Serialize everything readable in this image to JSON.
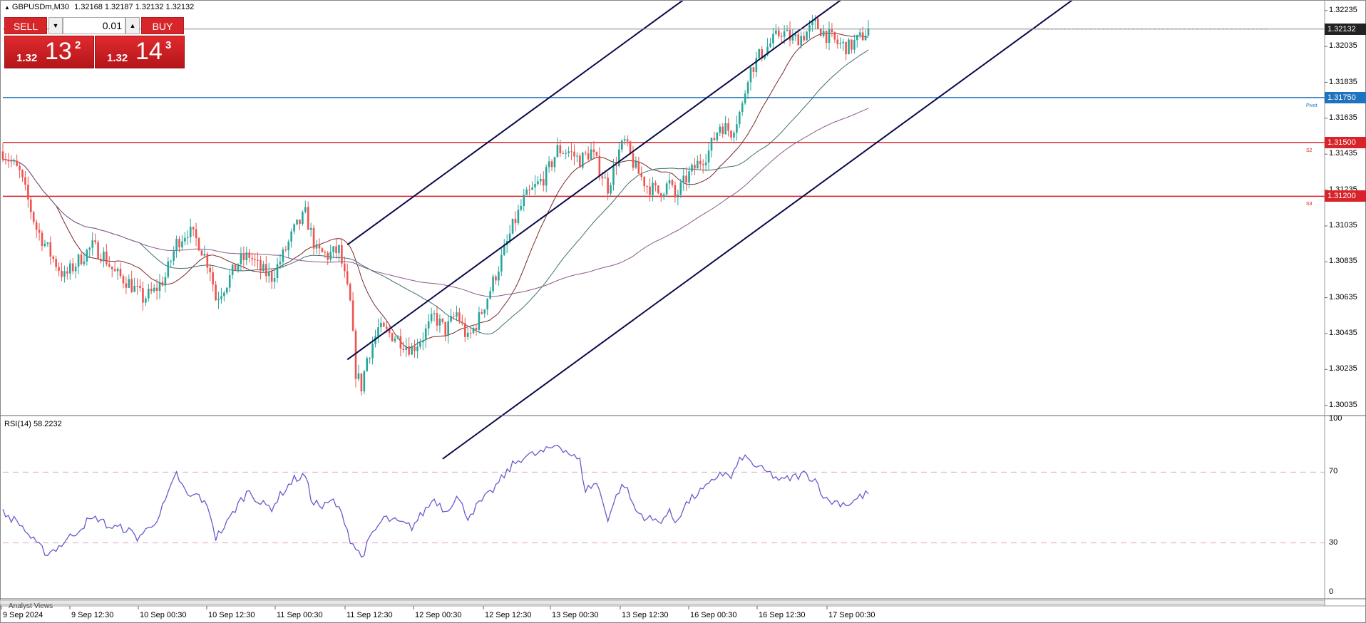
{
  "title": {
    "symbol": "GBPUSDm,M30",
    "ohlc": "1.32168 1.32187 1.32132 1.32132"
  },
  "one_click": {
    "sell_label": "SELL",
    "buy_label": "BUY",
    "lot": "0.01",
    "sell_price": {
      "small": "1.32",
      "big": "13",
      "sup": "2"
    },
    "buy_price": {
      "small": "1.32",
      "big": "14",
      "sup": "3"
    }
  },
  "price_axis": {
    "ticks": [
      1.32235,
      1.32035,
      1.31835,
      1.31635,
      1.31435,
      1.31235,
      1.31035,
      1.30835,
      1.30635,
      1.30435,
      1.30235,
      1.30035
    ],
    "tick_labels": [
      "1.32235",
      "1.32035",
      "1.31835",
      "1.31635",
      "1.31435",
      "1.31235",
      "1.31035",
      "1.30835",
      "1.30635",
      "1.30435",
      "1.30235",
      "1.30035"
    ]
  },
  "current_price": {
    "value": 1.32132,
    "label": "1.32132",
    "color": "#000000"
  },
  "levels": [
    {
      "name": "Pivot",
      "value": 1.3175,
      "label": "1.31750",
      "tag": "Pivot",
      "color": "#1e73be"
    },
    {
      "name": "S2",
      "value": 1.315,
      "label": "1.31500",
      "tag": "S2",
      "color": "#d9232a"
    },
    {
      "name": "S3",
      "value": 1.312,
      "label": "1.31200",
      "tag": "S3",
      "color": "#d9232a"
    }
  ],
  "time_axis": {
    "labels": [
      "9 Sep 2024",
      "9 Sep 12:30",
      "10 Sep 00:30",
      "10 Sep 12:30",
      "11 Sep 00:30",
      "11 Sep 12:30",
      "12 Sep 00:30",
      "12 Sep 12:30",
      "13 Sep 00:30",
      "13 Sep 12:30",
      "16 Sep 00:30",
      "16 Sep 12:30",
      "17 Sep 00:30"
    ]
  },
  "rsi": {
    "title": "RSI(14) 58.2232",
    "scale_labels": [
      "100",
      "70",
      "30",
      "0"
    ],
    "levels": [
      70,
      30
    ],
    "color": "#6a5acd"
  },
  "bottom_panel_label": "Analyst Views",
  "colors": {
    "bull": "#26a69a",
    "bear": "#ef5350",
    "channel": "#0a0a4a",
    "ma_fast": "#7a2a2a",
    "ma_mid": "#3f6e6e",
    "ma_slow": "#8a5a8a"
  },
  "chart_data": {
    "type": "candlestick",
    "symbol": "GBPUSDm",
    "timeframe": "M30",
    "ylim": [
      1.2999,
      1.3227
    ],
    "close_path": [
      {
        "t": 0,
        "p": 1.3145
      },
      {
        "t": 6,
        "p": 1.3133
      },
      {
        "t": 12,
        "p": 1.3102
      },
      {
        "t": 18,
        "p": 1.3085
      },
      {
        "t": 22,
        "p": 1.3075
      },
      {
        "t": 28,
        "p": 1.3086
      },
      {
        "t": 32,
        "p": 1.3092
      },
      {
        "t": 36,
        "p": 1.3087
      },
      {
        "t": 40,
        "p": 1.3077
      },
      {
        "t": 45,
        "p": 1.3072
      },
      {
        "t": 50,
        "p": 1.3063
      },
      {
        "t": 54,
        "p": 1.3067
      },
      {
        "t": 58,
        "p": 1.3075
      },
      {
        "t": 62,
        "p": 1.3094
      },
      {
        "t": 66,
        "p": 1.3101
      },
      {
        "t": 70,
        "p": 1.3094
      },
      {
        "t": 74,
        "p": 1.308
      },
      {
        "t": 76,
        "p": 1.3063
      },
      {
        "t": 80,
        "p": 1.3072
      },
      {
        "t": 84,
        "p": 1.3083
      },
      {
        "t": 88,
        "p": 1.3087
      },
      {
        "t": 92,
        "p": 1.3079
      },
      {
        "t": 96,
        "p": 1.3075
      },
      {
        "t": 100,
        "p": 1.3087
      },
      {
        "t": 104,
        "p": 1.3101
      },
      {
        "t": 108,
        "p": 1.311
      },
      {
        "t": 112,
        "p": 1.3089
      },
      {
        "t": 116,
        "p": 1.3087
      },
      {
        "t": 120,
        "p": 1.309
      },
      {
        "t": 124,
        "p": 1.306
      },
      {
        "t": 126,
        "p": 1.3022
      },
      {
        "t": 128,
        "p": 1.3014
      },
      {
        "t": 130,
        "p": 1.303
      },
      {
        "t": 134,
        "p": 1.3046
      },
      {
        "t": 140,
        "p": 1.3042
      },
      {
        "t": 146,
        "p": 1.3035
      },
      {
        "t": 150,
        "p": 1.3042
      },
      {
        "t": 154,
        "p": 1.3053
      },
      {
        "t": 158,
        "p": 1.3045
      },
      {
        "t": 162,
        "p": 1.3055
      },
      {
        "t": 166,
        "p": 1.304
      },
      {
        "t": 170,
        "p": 1.3052
      },
      {
        "t": 174,
        "p": 1.3068
      },
      {
        "t": 178,
        "p": 1.3085
      },
      {
        "t": 182,
        "p": 1.3103
      },
      {
        "t": 186,
        "p": 1.3118
      },
      {
        "t": 190,
        "p": 1.3125
      },
      {
        "t": 194,
        "p": 1.3132
      },
      {
        "t": 198,
        "p": 1.3146
      },
      {
        "t": 202,
        "p": 1.3145
      },
      {
        "t": 206,
        "p": 1.314
      },
      {
        "t": 210,
        "p": 1.3145
      },
      {
        "t": 214,
        "p": 1.3132
      },
      {
        "t": 216,
        "p": 1.3125
      },
      {
        "t": 220,
        "p": 1.3145
      },
      {
        "t": 222,
        "p": 1.315
      },
      {
        "t": 226,
        "p": 1.3135
      },
      {
        "t": 230,
        "p": 1.3126
      },
      {
        "t": 234,
        "p": 1.3122
      },
      {
        "t": 238,
        "p": 1.3127
      },
      {
        "t": 240,
        "p": 1.3119
      },
      {
        "t": 244,
        "p": 1.313
      },
      {
        "t": 248,
        "p": 1.3138
      },
      {
        "t": 252,
        "p": 1.3145
      },
      {
        "t": 256,
        "p": 1.316
      },
      {
        "t": 260,
        "p": 1.3156
      },
      {
        "t": 264,
        "p": 1.317
      },
      {
        "t": 266,
        "p": 1.3188
      },
      {
        "t": 270,
        "p": 1.3198
      },
      {
        "t": 274,
        "p": 1.3205
      },
      {
        "t": 278,
        "p": 1.3212
      },
      {
        "t": 282,
        "p": 1.3207
      },
      {
        "t": 286,
        "p": 1.321
      },
      {
        "t": 290,
        "p": 1.3216
      },
      {
        "t": 294,
        "p": 1.321
      },
      {
        "t": 298,
        "p": 1.3205
      },
      {
        "t": 302,
        "p": 1.3203
      },
      {
        "t": 306,
        "p": 1.3208
      },
      {
        "t": 309,
        "p": 1.3213
      }
    ],
    "rsi_path": [
      {
        "t": 0,
        "v": 47
      },
      {
        "t": 6,
        "v": 41
      },
      {
        "t": 12,
        "v": 29
      },
      {
        "t": 16,
        "v": 24
      },
      {
        "t": 20,
        "v": 28
      },
      {
        "t": 26,
        "v": 36
      },
      {
        "t": 30,
        "v": 42
      },
      {
        "t": 34,
        "v": 44
      },
      {
        "t": 38,
        "v": 39
      },
      {
        "t": 44,
        "v": 38
      },
      {
        "t": 48,
        "v": 33
      },
      {
        "t": 52,
        "v": 38
      },
      {
        "t": 56,
        "v": 46
      },
      {
        "t": 60,
        "v": 61
      },
      {
        "t": 62,
        "v": 69
      },
      {
        "t": 66,
        "v": 56
      },
      {
        "t": 70,
        "v": 57
      },
      {
        "t": 74,
        "v": 47
      },
      {
        "t": 76,
        "v": 33
      },
      {
        "t": 80,
        "v": 41
      },
      {
        "t": 84,
        "v": 52
      },
      {
        "t": 88,
        "v": 60
      },
      {
        "t": 92,
        "v": 52
      },
      {
        "t": 96,
        "v": 50
      },
      {
        "t": 100,
        "v": 59
      },
      {
        "t": 104,
        "v": 66
      },
      {
        "t": 108,
        "v": 68
      },
      {
        "t": 110,
        "v": 55
      },
      {
        "t": 114,
        "v": 50
      },
      {
        "t": 118,
        "v": 54
      },
      {
        "t": 122,
        "v": 43
      },
      {
        "t": 124,
        "v": 32
      },
      {
        "t": 128,
        "v": 22
      },
      {
        "t": 132,
        "v": 35
      },
      {
        "t": 136,
        "v": 44
      },
      {
        "t": 140,
        "v": 42
      },
      {
        "t": 146,
        "v": 39
      },
      {
        "t": 150,
        "v": 47
      },
      {
        "t": 154,
        "v": 55
      },
      {
        "t": 158,
        "v": 48
      },
      {
        "t": 162,
        "v": 56
      },
      {
        "t": 166,
        "v": 45
      },
      {
        "t": 170,
        "v": 52
      },
      {
        "t": 174,
        "v": 58
      },
      {
        "t": 178,
        "v": 66
      },
      {
        "t": 182,
        "v": 74
      },
      {
        "t": 186,
        "v": 79
      },
      {
        "t": 190,
        "v": 80
      },
      {
        "t": 194,
        "v": 82
      },
      {
        "t": 198,
        "v": 86
      },
      {
        "t": 202,
        "v": 81
      },
      {
        "t": 206,
        "v": 76
      },
      {
        "t": 208,
        "v": 60
      },
      {
        "t": 212,
        "v": 64
      },
      {
        "t": 216,
        "v": 44
      },
      {
        "t": 220,
        "v": 60
      },
      {
        "t": 222,
        "v": 63
      },
      {
        "t": 226,
        "v": 48
      },
      {
        "t": 230,
        "v": 44
      },
      {
        "t": 234,
        "v": 42
      },
      {
        "t": 238,
        "v": 47
      },
      {
        "t": 240,
        "v": 42
      },
      {
        "t": 244,
        "v": 52
      },
      {
        "t": 248,
        "v": 58
      },
      {
        "t": 252,
        "v": 62
      },
      {
        "t": 256,
        "v": 70
      },
      {
        "t": 260,
        "v": 67
      },
      {
        "t": 264,
        "v": 79
      },
      {
        "t": 266,
        "v": 77
      },
      {
        "t": 270,
        "v": 72
      },
      {
        "t": 274,
        "v": 69
      },
      {
        "t": 278,
        "v": 65
      },
      {
        "t": 282,
        "v": 67
      },
      {
        "t": 286,
        "v": 69
      },
      {
        "t": 290,
        "v": 66
      },
      {
        "t": 294,
        "v": 54
      },
      {
        "t": 298,
        "v": 53
      },
      {
        "t": 302,
        "v": 52
      },
      {
        "t": 306,
        "v": 56
      },
      {
        "t": 309,
        "v": 58
      }
    ]
  }
}
